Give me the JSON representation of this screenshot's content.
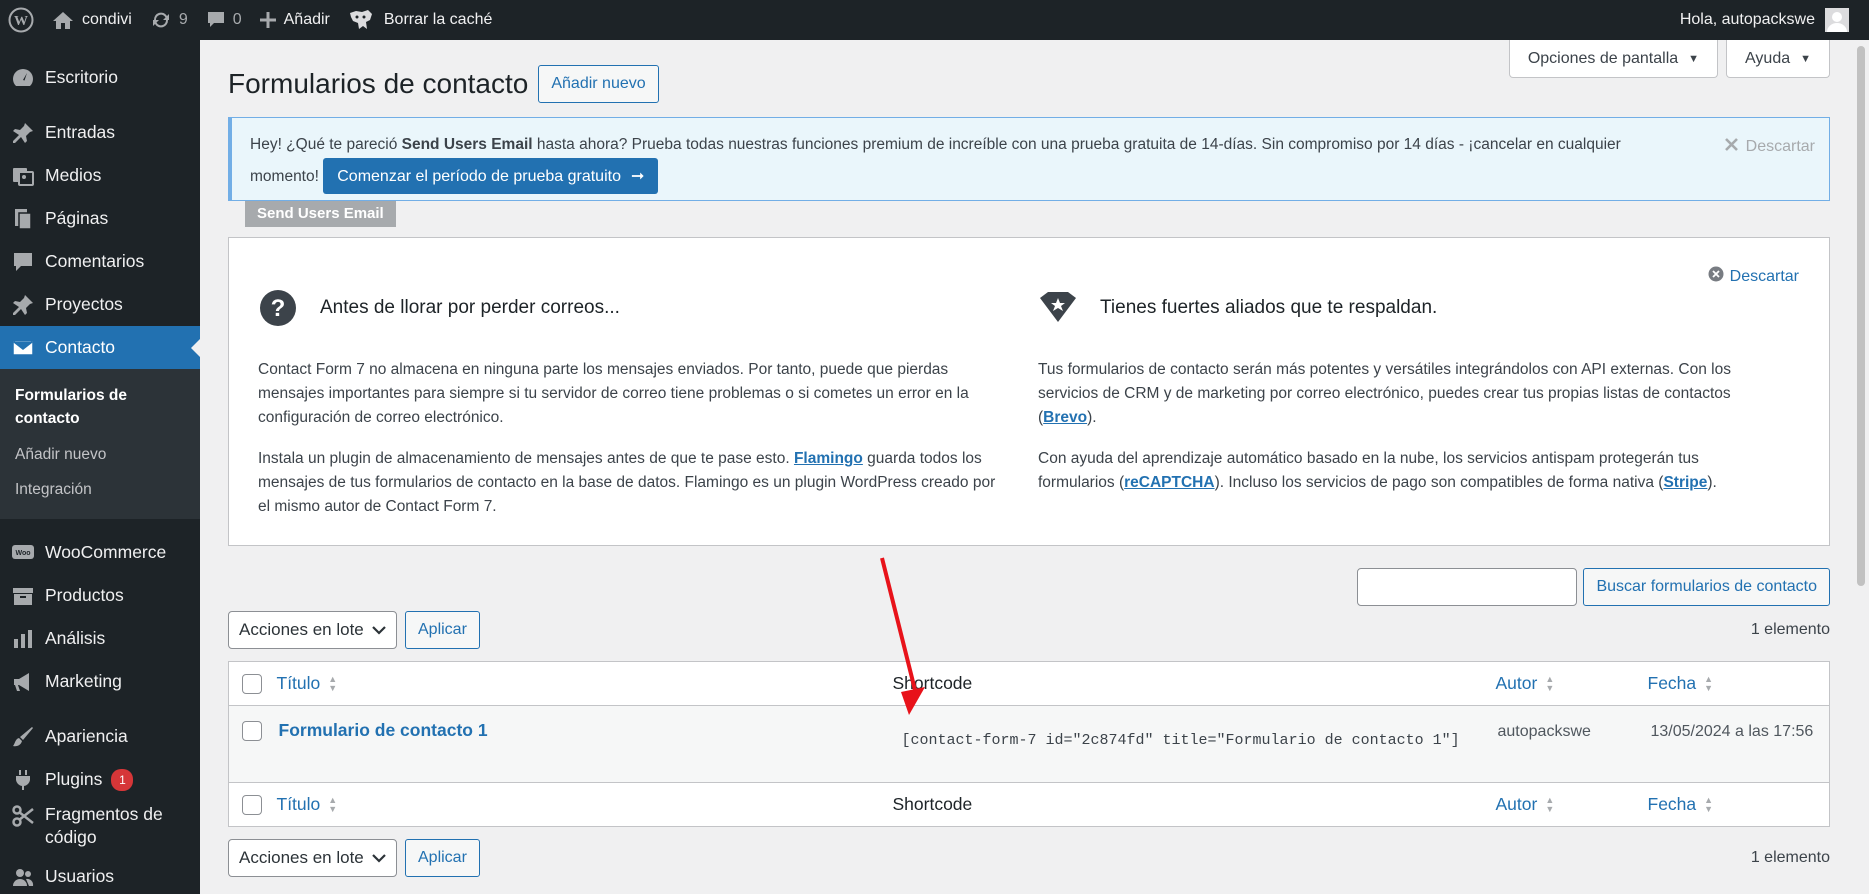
{
  "adminbar": {
    "site_name": "condivi",
    "updates_count": "9",
    "comments_count": "0",
    "new_label": "Añadir",
    "cache_label": "Borrar la caché",
    "greeting": "Hola, autopackswe"
  },
  "sidebar": {
    "items": [
      {
        "label": "Escritorio",
        "icon": "dashboard-icon"
      },
      {
        "label": "Entradas",
        "icon": "pin-icon"
      },
      {
        "label": "Medios",
        "icon": "media-icon"
      },
      {
        "label": "Páginas",
        "icon": "pages-icon"
      },
      {
        "label": "Comentarios",
        "icon": "comment-icon"
      },
      {
        "label": "Proyectos",
        "icon": "pin-icon"
      },
      {
        "label": "Contacto",
        "icon": "mail-icon"
      }
    ],
    "submenu": [
      "Formularios de contacto",
      "Añadir nuevo",
      "Integración"
    ],
    "items2": [
      {
        "label": "WooCommerce",
        "icon": "woo-icon"
      },
      {
        "label": "Productos",
        "icon": "archive-icon"
      },
      {
        "label": "Análisis",
        "icon": "chart-icon"
      },
      {
        "label": "Marketing",
        "icon": "megaphone-icon"
      }
    ],
    "items3": [
      {
        "label": "Apariencia",
        "icon": "brush-icon"
      },
      {
        "label": "Plugins",
        "icon": "plug-icon",
        "badge": "1"
      },
      {
        "label": "Fragmentos de código",
        "icon": "scissors-icon"
      },
      {
        "label": "Usuarios",
        "icon": "users-icon"
      }
    ]
  },
  "screen_options": "Opciones de pantalla",
  "help": "Ayuda",
  "page_title": "Formularios de contacto",
  "add_new": "Añadir nuevo",
  "notice": {
    "text_1": "Hey! ¿Qué te pareció ",
    "text_bold": "Send Users Email",
    "text_2": " hasta ahora? Prueba todas nuestras funciones premium de increíble con una prueba gratuita de 14-días. Sin compromiso por 14 días - ¡cancelar en cualquier momento!",
    "cta": "Comenzar el período de prueba gratuito",
    "dismiss": "Descartar",
    "tag": "Send Users Email"
  },
  "welcome": {
    "dismiss": "Descartar",
    "left_title": "Antes de llorar por perder correos...",
    "left_p1": "Contact Form 7 no almacena en ninguna parte los mensajes enviados. Por tanto, puede que pierdas mensajes importantes para siempre si tu servidor de correo tiene problemas o si cometes un error en la configuración de correo electrónico.",
    "left_p2_a": "Instala un plugin de almacenamiento de mensajes antes de que te pase esto. ",
    "left_p2_link": "Flamingo",
    "left_p2_b": " guarda todos los mensajes de tus formularios de contacto en la base de datos. Flamingo es un plugin WordPress creado por el mismo autor de Contact Form 7.",
    "right_title": "Tienes fuertes aliados que te respaldan.",
    "right_p1_a": "Tus formularios de contacto serán más potentes y versátiles integrándolos con API externas. Con los servicios de CRM y de marketing por correo electrónico, puedes crear tus propias listas de contactos (",
    "right_p1_link": "Brevo",
    "right_p1_b": ").",
    "right_p2_a": "Con ayuda del aprendizaje automático basado en la nube, los servicios antispam protegerán tus formularios (",
    "right_p2_link1": "reCAPTCHA",
    "right_p2_b": "). Incluso los servicios de pago son compatibles de forma nativa (",
    "right_p2_link2": "Stripe",
    "right_p2_c": ")."
  },
  "search_button": "Buscar formularios de contacto",
  "bulk_actions": "Acciones en lote",
  "apply": "Aplicar",
  "items_count": "1 elemento",
  "columns": {
    "title": "Título",
    "shortcode": "Shortcode",
    "author": "Autor",
    "date": "Fecha"
  },
  "rows": [
    {
      "title": "Formulario de contacto 1",
      "shortcode": "[contact-form-7 id=\"2c874fd\" title=\"Formulario de contacto 1\"]",
      "author": "autopackswe",
      "date": "13/05/2024 a las 17:56"
    }
  ],
  "annotation_color": "#e8121a"
}
